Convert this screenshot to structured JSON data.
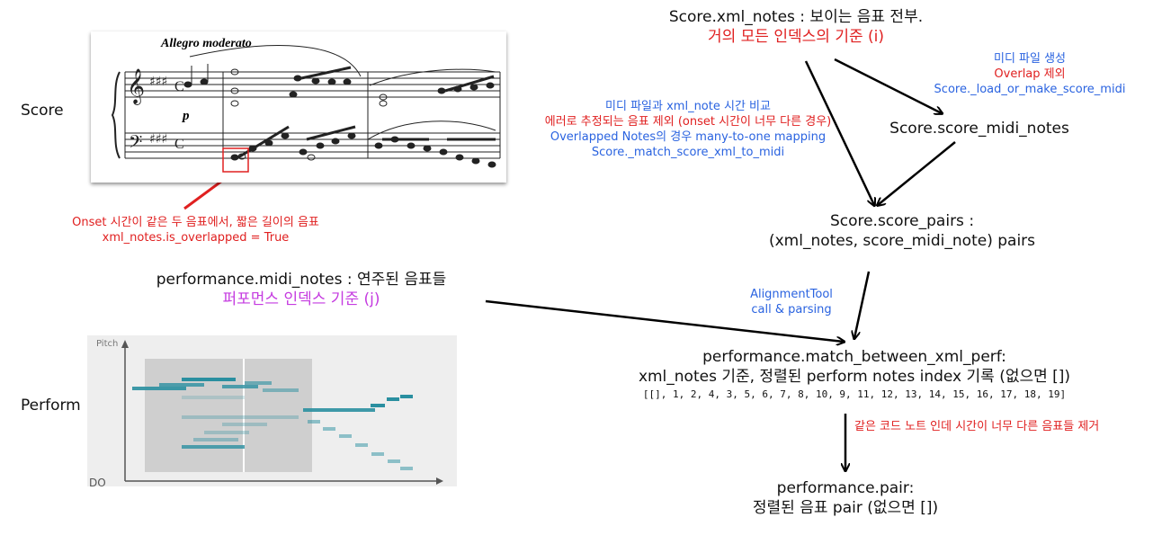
{
  "left": {
    "score_label": "Score",
    "score_tempo": "Allegro moderato",
    "score_dynamic": "p",
    "overlap_note": [
      "Onset 시간이 같은 두 음표에서, 짧은 길이의 음표",
      "xml_notes.is_overlapped = True"
    ],
    "perf_title": "performance.midi_notes : 연주된 음표들",
    "perf_subtitle": "퍼포먼스 인덱스 기준 (j)",
    "perform_label": "Perform",
    "pitch_label": "Pitch",
    "do_label": "DO"
  },
  "nodes": {
    "xml_notes": {
      "line1": "Score.xml_notes : 보이는 음표 전부.",
      "line2": "거의 모든 인덱스의 기준 (i)"
    },
    "score_midi_notes": {
      "label": "Score.score_midi_notes"
    },
    "score_pairs": {
      "line1": "Score.score_pairs :",
      "line2": "(xml_notes, score_midi_note) pairs"
    },
    "match": {
      "line1": "performance.match_between_xml_perf:",
      "line2": "xml_notes 기준, 정렬된 perform notes index 기록 (없으면 [])",
      "array": "[[], 1, 2, 4, 3, 5, 6, 7, 8, 10, 9, 11, 12, 13, 14, 15, 16, 17, 18, 19]"
    },
    "pair": {
      "line1": "performance.pair:",
      "line2": "정렬된 음표 pair (없으면 [])"
    }
  },
  "edges": {
    "midi_gen": {
      "line1": "미디 파일 생성",
      "line2": "Overlap 제외",
      "line3": "Score._load_or_make_score_midi"
    },
    "compare": {
      "line1": "미디 파일과 xml_note 시간 비교",
      "line2": "에러로 추정되는 음표 제외 (onset 시간이 너무 다른 경우)",
      "line3": "Overlapped Notes의 경우 many-to-one mapping",
      "line4": "Score._match_score_xml_to_midi"
    },
    "alignment": {
      "line1": "AlignmentTool",
      "line2": "call & parsing"
    },
    "remove": {
      "label": "같은 코드 노트 인데 시간이 너무 다른 음표들 제거"
    }
  },
  "colors": {
    "red": "#e02020",
    "blue": "#2a63e0",
    "purple": "#c53be0",
    "teal": "#2a8fa0"
  }
}
